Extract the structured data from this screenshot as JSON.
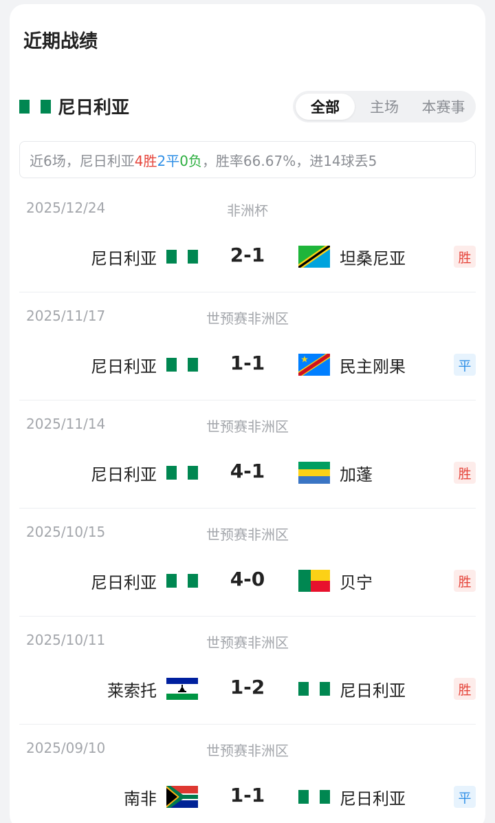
{
  "title": "近期战绩",
  "team": {
    "name": "尼日利亚",
    "flag": "nigeria-flag-icon"
  },
  "tabs": [
    {
      "label": "全部",
      "active": true
    },
    {
      "label": "主场",
      "active": false
    },
    {
      "label": "本赛事",
      "active": false
    }
  ],
  "summary": {
    "prefix": "近6场，尼日利亚",
    "wins": "4胜",
    "draws": "2平",
    "losses": "0负",
    "suffix": "，胜率66.67%，进14球丢5"
  },
  "colors": {
    "win": "#e5453b",
    "draw": "#2f8fe6",
    "loss": "#2cae3f"
  },
  "matches": [
    {
      "date": "2025/12/24",
      "competition": "非洲杯",
      "home": "尼日利亚",
      "home_flag": "nigeria",
      "score": "2-1",
      "away": "坦桑尼亚",
      "away_flag": "tanzania",
      "result": "胜",
      "result_type": "win"
    },
    {
      "date": "2025/11/17",
      "competition": "世预赛非洲区",
      "home": "尼日利亚",
      "home_flag": "nigeria",
      "score": "1-1",
      "away": "民主刚果",
      "away_flag": "drcongo",
      "result": "平",
      "result_type": "draw"
    },
    {
      "date": "2025/11/14",
      "competition": "世预赛非洲区",
      "home": "尼日利亚",
      "home_flag": "nigeria",
      "score": "4-1",
      "away": "加蓬",
      "away_flag": "gabon",
      "result": "胜",
      "result_type": "win"
    },
    {
      "date": "2025/10/15",
      "competition": "世预赛非洲区",
      "home": "尼日利亚",
      "home_flag": "nigeria",
      "score": "4-0",
      "away": "贝宁",
      "away_flag": "benin",
      "result": "胜",
      "result_type": "win"
    },
    {
      "date": "2025/10/11",
      "competition": "世预赛非洲区",
      "home": "莱索托",
      "home_flag": "lesotho",
      "score": "1-2",
      "away": "尼日利亚",
      "away_flag": "nigeria",
      "result": "胜",
      "result_type": "win"
    },
    {
      "date": "2025/09/10",
      "competition": "世预赛非洲区",
      "home": "南非",
      "home_flag": "southafrica",
      "score": "1-1",
      "away": "尼日利亚",
      "away_flag": "nigeria",
      "result": "平",
      "result_type": "draw"
    }
  ]
}
